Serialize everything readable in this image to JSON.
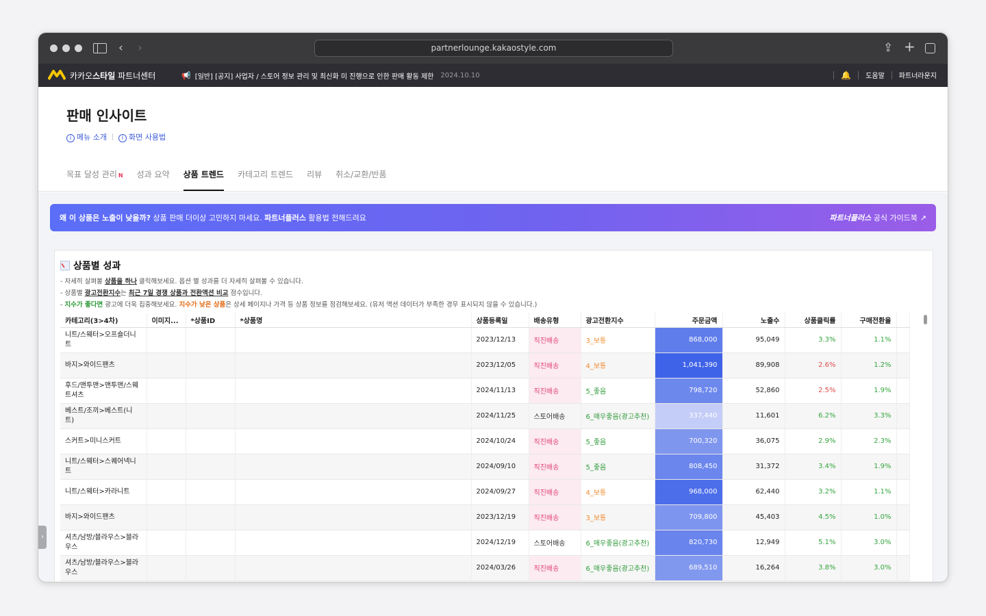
{
  "browser": {
    "url": "partnerlounge.kakaostyle.com"
  },
  "appbar": {
    "brand_light": "카카오",
    "brand_bold": "스타일",
    "brand_suffix": " 파트너센터",
    "notice": "[일반] [공지] 사업자 / 스토어 정보 관리 및 최신화 미 진행으로 인한 판매 활동 제한",
    "notice_date": "2024.10.10",
    "help": "도움말",
    "partner_lounge": "파트너라운지"
  },
  "page": {
    "title": "판매 인사이트",
    "menu_intro": "메뉴 소개",
    "screen_usage": "화면 사용법",
    "tabs": [
      {
        "label": "목표 달성 관리",
        "badge": "N"
      },
      {
        "label": "성과 요약"
      },
      {
        "label": "상품 트렌드"
      },
      {
        "label": "카테고리 트렌드"
      },
      {
        "label": "리뷰"
      },
      {
        "label": "취소/교환/반품"
      }
    ]
  },
  "banner": {
    "q": "왜 이 상품은 노출이 낮을까?",
    "t1": " 상품 판매 더이상 고민하지 마세요. ",
    "b2": "파트너플러스",
    "t2": " 활용법 전해드려요",
    "guide_bold": "파트너플러스",
    "guide_text": " 공식 가이드북"
  },
  "panel": {
    "title": "상품별 성과",
    "d1a": "- 자세히 살펴볼 ",
    "d1b": "상품을 하나",
    "d1c": " 클릭해보세요. 옵션 별 성과를 더 자세히 살펴볼 수 있습니다.",
    "d2a": "- 상품별 ",
    "d2b": "광고전환지수",
    "d2c": "는 ",
    "d2d": "최근 7일 경쟁 상품과 전환액션 비교",
    "d2e": " 점수입니다.",
    "d3a": "- ",
    "d3b": "지수가 좋다면",
    "d3c": " 광고에 더욱 집중해보세요. ",
    "d3d": "지수가 낮은 상품",
    "d3e": "은 상세 페이지나 가격 등 상품 정보를 점검해보세요. (유저 액션 데이터가 부족한 경우 표시되지 않을 수 있습니다.)"
  },
  "table": {
    "headers": [
      "카테고리(3>4차)",
      "이미지...",
      "*상품ID",
      "*상품명",
      "상품등록일",
      "배송유형",
      "광고전환지수",
      "주문금액",
      "노출수",
      "상품클릭률",
      "구매전환율"
    ],
    "rows": [
      {
        "cat": "니트/스웨터>오프숄더니트",
        "date": "2023/12/13",
        "ship": "직진배송",
        "idx": "3_보통",
        "amount": "868,000",
        "imp": "95,049",
        "ctr": "3.3%",
        "cvr": "1.1%",
        "ctr_c": "green"
      },
      {
        "cat": "바지>와이드팬츠",
        "date": "2023/12/05",
        "ship": "직진배송",
        "idx": "4_보통",
        "amount": "1,041,390",
        "imp": "89,908",
        "ctr": "2.6%",
        "cvr": "1.2%",
        "ctr_c": "red"
      },
      {
        "cat": "후드/맨투맨>맨투맨/스웨트셔츠",
        "date": "2024/11/13",
        "ship": "직진배송",
        "idx": "5_좋음",
        "amount": "798,720",
        "imp": "52,860",
        "ctr": "2.5%",
        "cvr": "1.9%",
        "ctr_c": "red"
      },
      {
        "cat": "베스트/조끼>베스트(니트)",
        "date": "2024/11/25",
        "ship": "스토어배송",
        "idx": "6_매우좋음(광고추천)",
        "amount": "337,440",
        "imp": "11,601",
        "ctr": "6.2%",
        "cvr": "3.3%",
        "ctr_c": "green"
      },
      {
        "cat": "스커트>미니스커트",
        "date": "2024/10/24",
        "ship": "직진배송",
        "idx": "5_좋음",
        "amount": "700,320",
        "imp": "36,075",
        "ctr": "2.9%",
        "cvr": "2.3%",
        "ctr_c": "green"
      },
      {
        "cat": "니트/스웨터>스퀘어넥니트",
        "date": "2024/09/10",
        "ship": "직진배송",
        "idx": "5_좋음",
        "amount": "808,450",
        "imp": "31,372",
        "ctr": "3.4%",
        "cvr": "1.9%",
        "ctr_c": "green"
      },
      {
        "cat": "니트/스웨터>카라니트",
        "date": "2024/09/27",
        "ship": "직진배송",
        "idx": "4_보통",
        "amount": "968,000",
        "imp": "62,440",
        "ctr": "3.2%",
        "cvr": "1.1%",
        "ctr_c": "green"
      },
      {
        "cat": "바지>와이드팬츠",
        "date": "2023/12/19",
        "ship": "직진배송",
        "idx": "3_보통",
        "amount": "709,800",
        "imp": "45,403",
        "ctr": "4.5%",
        "cvr": "1.0%",
        "ctr_c": "green"
      },
      {
        "cat": "셔츠/남방/블라우스>블라우스",
        "date": "2024/12/19",
        "ship": "스토어배송",
        "idx": "6_매우좋음(광고추천)",
        "amount": "820,730",
        "imp": "12,949",
        "ctr": "5.1%",
        "cvr": "3.0%",
        "ctr_c": "green"
      },
      {
        "cat": "셔츠/남방/블라우스>블라우스",
        "date": "2024/03/26",
        "ship": "직진배송",
        "idx": "6_매우좋음(광고추천)",
        "amount": "689,510",
        "imp": "16,264",
        "ctr": "3.8%",
        "cvr": "3.0%",
        "ctr_c": "green"
      }
    ]
  },
  "colors": {
    "amount_low": "#c4cdf7",
    "amount_high": "#3f63e8",
    "banner_start": "#5b6ef7",
    "banner_end": "#9a5de8"
  }
}
